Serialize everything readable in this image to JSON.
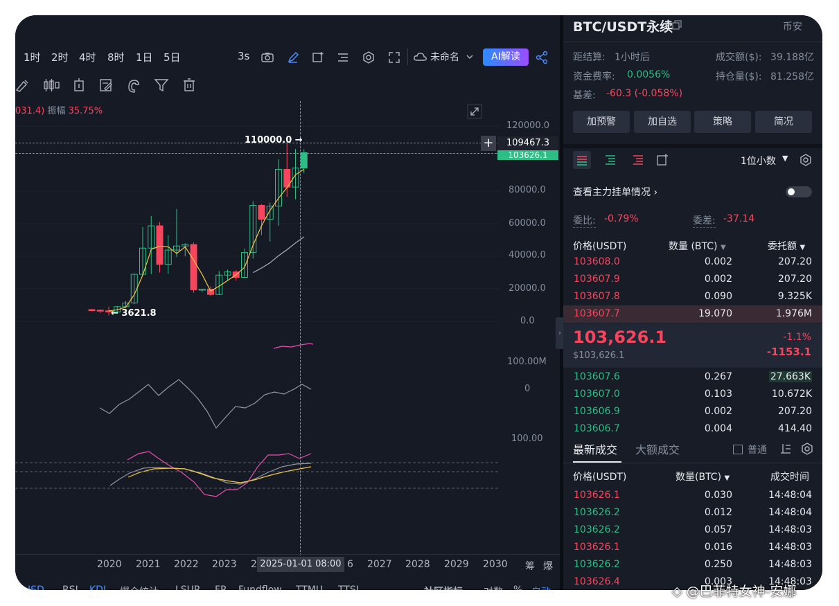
{
  "toolbar": {
    "timeframes": [
      "1时",
      "2时",
      "4时",
      "8时",
      "1日",
      "5日"
    ],
    "interval": "3s",
    "layout_name": "未命名",
    "ai_button": "AI解读"
  },
  "chart": {
    "amplitude_prefix": "031.4)",
    "amplitude_label": "振幅",
    "amplitude_value": "35.75%",
    "high_label": "110000.0",
    "low_label": "3621.8",
    "crosshair_price": "109467.3",
    "last_price_tag": "103626.1",
    "crosshair_date": "2025-01-01 08:00",
    "y_ticks": [
      "120000.0",
      "80000.0",
      "60000.0",
      "40000.0",
      "20000.0",
      "0.0"
    ],
    "volume_tick": "100.00M",
    "macd_tick": "0",
    "kdj_tick": "100.00",
    "x_ticks": [
      "2020",
      "2021",
      "2022",
      "2023",
      "2",
      "6",
      "2027",
      "2028",
      "2029",
      "2030"
    ],
    "x_right": [
      "筹",
      "爆"
    ],
    "indicator_tabs": [
      "ISD",
      "RSI",
      "KDJ",
      "爆仓统计",
      "LSUR",
      "FR",
      "Fundflow",
      "TTMU",
      "TTSL"
    ],
    "bottom_right": [
      "社区指标",
      "对数",
      "%",
      "自动"
    ],
    "candles": [
      {
        "o": 7200,
        "c": 6900,
        "h": 7600,
        "l": 6400
      },
      {
        "o": 6900,
        "c": 6500,
        "h": 7300,
        "l": 5000
      },
      {
        "o": 6500,
        "c": 5800,
        "h": 9000,
        "l": 3621.8
      },
      {
        "o": 5800,
        "c": 9000,
        "h": 9500,
        "l": 5500
      },
      {
        "o": 9000,
        "c": 11300,
        "h": 12500,
        "l": 8500
      },
      {
        "o": 11300,
        "c": 28900,
        "h": 29300,
        "l": 10500
      },
      {
        "o": 28900,
        "c": 45000,
        "h": 58000,
        "l": 28000
      },
      {
        "o": 45000,
        "c": 58700,
        "h": 64800,
        "l": 29000
      },
      {
        "o": 58700,
        "c": 35000,
        "h": 61000,
        "l": 30000
      },
      {
        "o": 35000,
        "c": 43800,
        "h": 52900,
        "l": 29200
      },
      {
        "o": 43800,
        "c": 46300,
        "h": 69000,
        "l": 39500
      },
      {
        "o": 46300,
        "c": 47200,
        "h": 48000,
        "l": 40000
      },
      {
        "o": 47200,
        "c": 19400,
        "h": 48500,
        "l": 17600
      },
      {
        "o": 19400,
        "c": 19800,
        "h": 20000,
        "l": 18000
      },
      {
        "o": 19800,
        "c": 16500,
        "h": 21500,
        "l": 15500
      },
      {
        "o": 16500,
        "c": 28400,
        "h": 31000,
        "l": 16500
      },
      {
        "o": 28400,
        "c": 30400,
        "h": 31800,
        "l": 25000
      },
      {
        "o": 30400,
        "c": 27000,
        "h": 31500,
        "l": 24900
      },
      {
        "o": 27000,
        "c": 42300,
        "h": 44700,
        "l": 26500
      },
      {
        "o": 42300,
        "c": 71300,
        "h": 73800,
        "l": 38500
      },
      {
        "o": 71300,
        "c": 62700,
        "h": 72000,
        "l": 53000
      },
      {
        "o": 62700,
        "c": 70800,
        "h": 73000,
        "l": 49000
      },
      {
        "o": 70800,
        "c": 93400,
        "h": 99600,
        "l": 58800
      },
      {
        "o": 93400,
        "c": 82500,
        "h": 110000,
        "l": 76500
      },
      {
        "o": 82500,
        "c": 94200,
        "h": 106000,
        "l": 75000
      },
      {
        "o": 94200,
        "c": 103626,
        "h": 105800,
        "l": 91000
      }
    ]
  },
  "panel": {
    "symbol": "BTC/USDT永续",
    "exchange": "币安",
    "settle_label": "距结算:",
    "settle_value": "1小时后",
    "volume_label": "成交额($):",
    "volume_value": "39.188亿",
    "funding_label": "资金费率:",
    "funding_value": "0.0056%",
    "oi_label": "持仓量($):",
    "oi_value": "81.258亿",
    "basis_label": "基差:",
    "basis_value": "-60.3 (-0.058%)",
    "buttons": [
      "加预警",
      "加自选",
      "策略",
      "简况"
    ],
    "precision": "1位小数",
    "big_order_label": "查看主力挂单情况",
    "ratio_label": "委比:",
    "ratio_value": "-0.79%",
    "diff_label": "委差:",
    "diff_value": "-37.14",
    "book_headers": [
      "价格(USDT)",
      "数量 (BTC)",
      "委托额"
    ],
    "asks": [
      [
        "103608.0",
        "0.002",
        "207.20"
      ],
      [
        "103607.9",
        "0.002",
        "207.20"
      ],
      [
        "103607.8",
        "0.090",
        "9.325K"
      ],
      [
        "103607.7",
        "19.070",
        "1.976M"
      ]
    ],
    "last_price": "103,626.1",
    "last_price_usd": "$103,626.1",
    "change_pct": "-1.1%",
    "change_abs": "-1153.1",
    "bids": [
      [
        "103607.6",
        "0.267",
        "27.663K"
      ],
      [
        "103607.0",
        "0.103",
        "10.672K"
      ],
      [
        "103606.9",
        "0.002",
        "207.20"
      ],
      [
        "103606.7",
        "0.004",
        "414.40"
      ]
    ],
    "trade_tab_latest": "最新成交",
    "trade_tab_big": "大额成交",
    "normal_label": "普通",
    "trade_headers": [
      "价格(USDT)",
      "数量(BTC)",
      "成交时间"
    ],
    "trades": [
      [
        "103626.1",
        "0.030",
        "14:48:04",
        "sell"
      ],
      [
        "103626.2",
        "0.012",
        "14:48:04",
        "buy"
      ],
      [
        "103626.2",
        "0.057",
        "14:48:03",
        "buy"
      ],
      [
        "103626.1",
        "0.016",
        "14:48:03",
        "sell"
      ],
      [
        "103626.2",
        "0.250",
        "14:48:03",
        "buy"
      ],
      [
        "103626.4",
        "0.003",
        "14:48:03",
        "sell"
      ]
    ]
  },
  "watermark": "@巴菲特女神-安娜",
  "colors": {
    "up": "#2ebd85",
    "down": "#f6465d",
    "accent": "#2962ff",
    "bg": "#161a25"
  }
}
